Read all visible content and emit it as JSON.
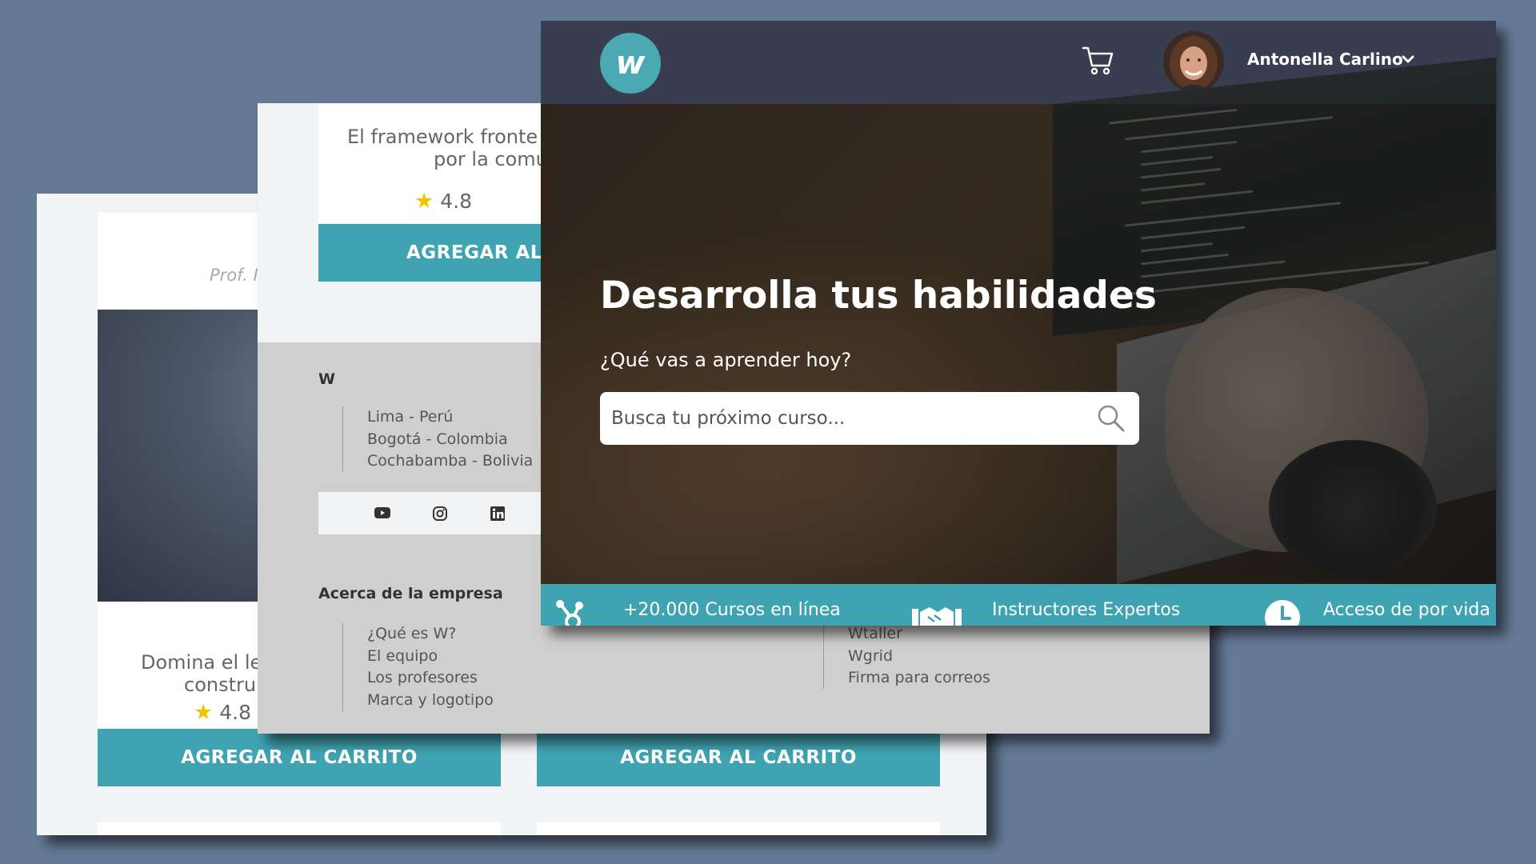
{
  "colors": {
    "background": "#657a96",
    "accent_teal": "#3fa3b1",
    "navbar": "#383d4f",
    "star": "#f2c200",
    "footer_gray": "#cfcfcf"
  },
  "back_window": {
    "card_left": {
      "instructor_fragment": "Prof. I",
      "description_lines": [
        "Domina el le",
        "constru"
      ],
      "rating": "4.8",
      "cart_button": "AGREGAR AL CARRITO"
    },
    "card_right": {
      "cart_button": "AGREGAR AL CARRITO"
    }
  },
  "middle_window": {
    "course_card": {
      "description_lines": [
        "El framework fronte",
        "por la comu"
      ],
      "rating": "4.8",
      "cart_button": "AGREGAR AL"
    },
    "footer": {
      "brand": "W",
      "locations": [
        "Lima - Perú",
        "Bogotá - Colombia",
        "Cochabamba - Bolivia"
      ],
      "social_icons": [
        "youtube-icon",
        "instagram-icon",
        "linkedin-icon"
      ],
      "about_title": "Acerca de la empresa",
      "about_links": [
        "¿Qué es W?",
        "El equipo",
        "Los profesores",
        "Marca y logotipo"
      ],
      "products_links": [
        "Wtaller",
        "Wgrid",
        "Firma para correos"
      ]
    }
  },
  "front_window": {
    "navbar": {
      "logo_letter": "w",
      "cart_icon": "cart-icon",
      "user_name": "Antonella Carlino",
      "user_menu_icon": "chevron-down-icon"
    },
    "hero": {
      "title": "Desarrolla tus habilidades",
      "subtitle": "¿Qué vas a aprender hoy?",
      "search_placeholder": "Busca tu próximo curso..."
    },
    "features": [
      {
        "icon": "network-icon",
        "label": "+20.000 Cursos en línea"
      },
      {
        "icon": "handshake-icon",
        "label": "Instructores Expertos"
      },
      {
        "icon": "clock-icon",
        "label": "Acceso de por vida"
      }
    ]
  }
}
